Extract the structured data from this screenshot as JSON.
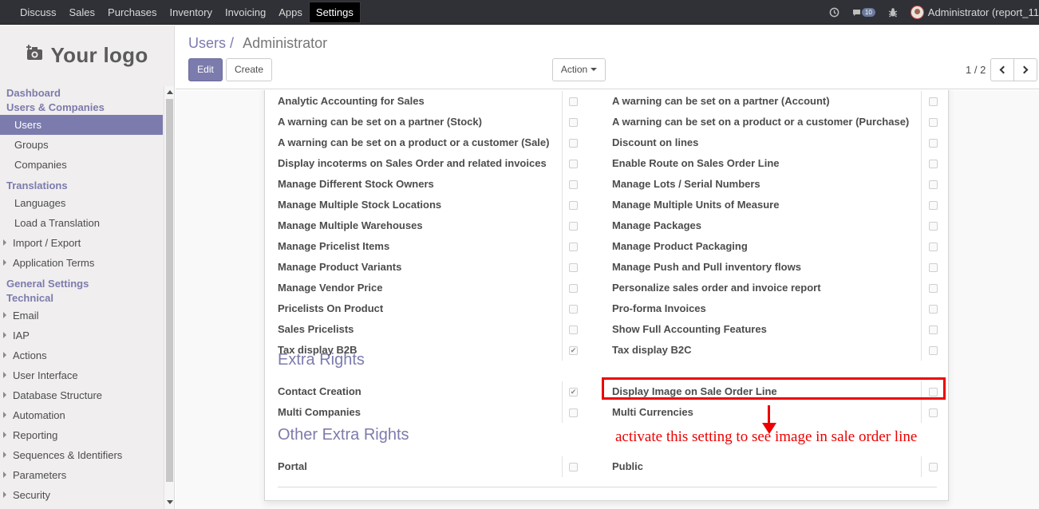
{
  "topbar": {
    "menu": [
      {
        "label": "Discuss",
        "active": false
      },
      {
        "label": "Sales",
        "active": false
      },
      {
        "label": "Purchases",
        "active": false
      },
      {
        "label": "Inventory",
        "active": false
      },
      {
        "label": "Invoicing",
        "active": false
      },
      {
        "label": "Apps",
        "active": false
      },
      {
        "label": "Settings",
        "active": true
      }
    ],
    "messages_count": "10",
    "user": "Administrator (report_11"
  },
  "sidebar": {
    "logo_text": "Your logo",
    "items": [
      {
        "type": "head",
        "label": "Dashboard"
      },
      {
        "type": "head",
        "label": "Users & Companies"
      },
      {
        "type": "sub",
        "label": "Users",
        "active": true
      },
      {
        "type": "sub",
        "label": "Groups"
      },
      {
        "type": "sub",
        "label": "Companies"
      },
      {
        "type": "head",
        "label": "Translations"
      },
      {
        "type": "sub",
        "label": "Languages"
      },
      {
        "type": "sub",
        "label": "Load a Translation"
      },
      {
        "type": "arrow",
        "label": "Import / Export"
      },
      {
        "type": "arrow",
        "label": "Application Terms"
      },
      {
        "type": "head",
        "label": "General Settings"
      },
      {
        "type": "head",
        "label": "Technical"
      },
      {
        "type": "arrow",
        "label": "Email"
      },
      {
        "type": "arrow",
        "label": "IAP"
      },
      {
        "type": "arrow",
        "label": "Actions"
      },
      {
        "type": "arrow",
        "label": "User Interface"
      },
      {
        "type": "arrow",
        "label": "Database Structure"
      },
      {
        "type": "arrow",
        "label": "Automation"
      },
      {
        "type": "arrow",
        "label": "Reporting"
      },
      {
        "type": "arrow",
        "label": "Sequences & Identifiers"
      },
      {
        "type": "arrow",
        "label": "Parameters"
      },
      {
        "type": "arrow",
        "label": "Security"
      }
    ]
  },
  "control": {
    "breadcrumb_parent": "Users",
    "breadcrumb_sep": "/",
    "breadcrumb_current": "Administrator",
    "edit_label": "Edit",
    "create_label": "Create",
    "action_label": "Action",
    "pager": "1 / 2"
  },
  "form": {
    "rights": [
      {
        "left": "Analytic Accounting for Sales",
        "left_checked": false,
        "right": "A warning can be set on a partner (Account)",
        "right_checked": false
      },
      {
        "left": "A warning can be set on a partner (Stock)",
        "left_checked": false,
        "right": "A warning can be set on a product or a customer (Purchase)",
        "right_checked": false
      },
      {
        "left": "A warning can be set on a product or a customer (Sale)",
        "left_checked": false,
        "right": "Discount on lines",
        "right_checked": false
      },
      {
        "left": "Display incoterms on Sales Order and related invoices",
        "left_checked": false,
        "right": "Enable Route on Sales Order Line",
        "right_checked": false
      },
      {
        "left": "Manage Different Stock Owners",
        "left_checked": false,
        "right": "Manage Lots / Serial Numbers",
        "right_checked": false
      },
      {
        "left": "Manage Multiple Stock Locations",
        "left_checked": false,
        "right": "Manage Multiple Units of Measure",
        "right_checked": false
      },
      {
        "left": "Manage Multiple Warehouses",
        "left_checked": false,
        "right": "Manage Packages",
        "right_checked": false
      },
      {
        "left": "Manage Pricelist Items",
        "left_checked": false,
        "right": "Manage Product Packaging",
        "right_checked": false
      },
      {
        "left": "Manage Product Variants",
        "left_checked": false,
        "right": "Manage Push and Pull inventory flows",
        "right_checked": false
      },
      {
        "left": "Manage Vendor Price",
        "left_checked": false,
        "right": "Personalize sales order and invoice report",
        "right_checked": false
      },
      {
        "left": "Pricelists On Product",
        "left_checked": false,
        "right": "Pro-forma Invoices",
        "right_checked": false
      },
      {
        "left": "Sales Pricelists",
        "left_checked": false,
        "right": "Show Full Accounting Features",
        "right_checked": false
      },
      {
        "left": "Tax display B2B",
        "left_checked": true,
        "right": "Tax display B2C",
        "right_checked": false
      }
    ],
    "extra_title": "Extra Rights",
    "extra_rights": [
      {
        "left": "Contact Creation",
        "left_checked": true,
        "right": "Display Image on Sale Order Line",
        "right_checked": false
      },
      {
        "left": "Multi Companies",
        "left_checked": false,
        "right": "Multi Currencies",
        "right_checked": false
      }
    ],
    "other_title": "Other Extra Rights",
    "other_rights": [
      {
        "left": "Portal",
        "left_checked": false,
        "right": "Public",
        "right_checked": false
      }
    ]
  },
  "annotation": {
    "note": "activate this setting to see image in sale order line",
    "color": "#ee0000"
  }
}
